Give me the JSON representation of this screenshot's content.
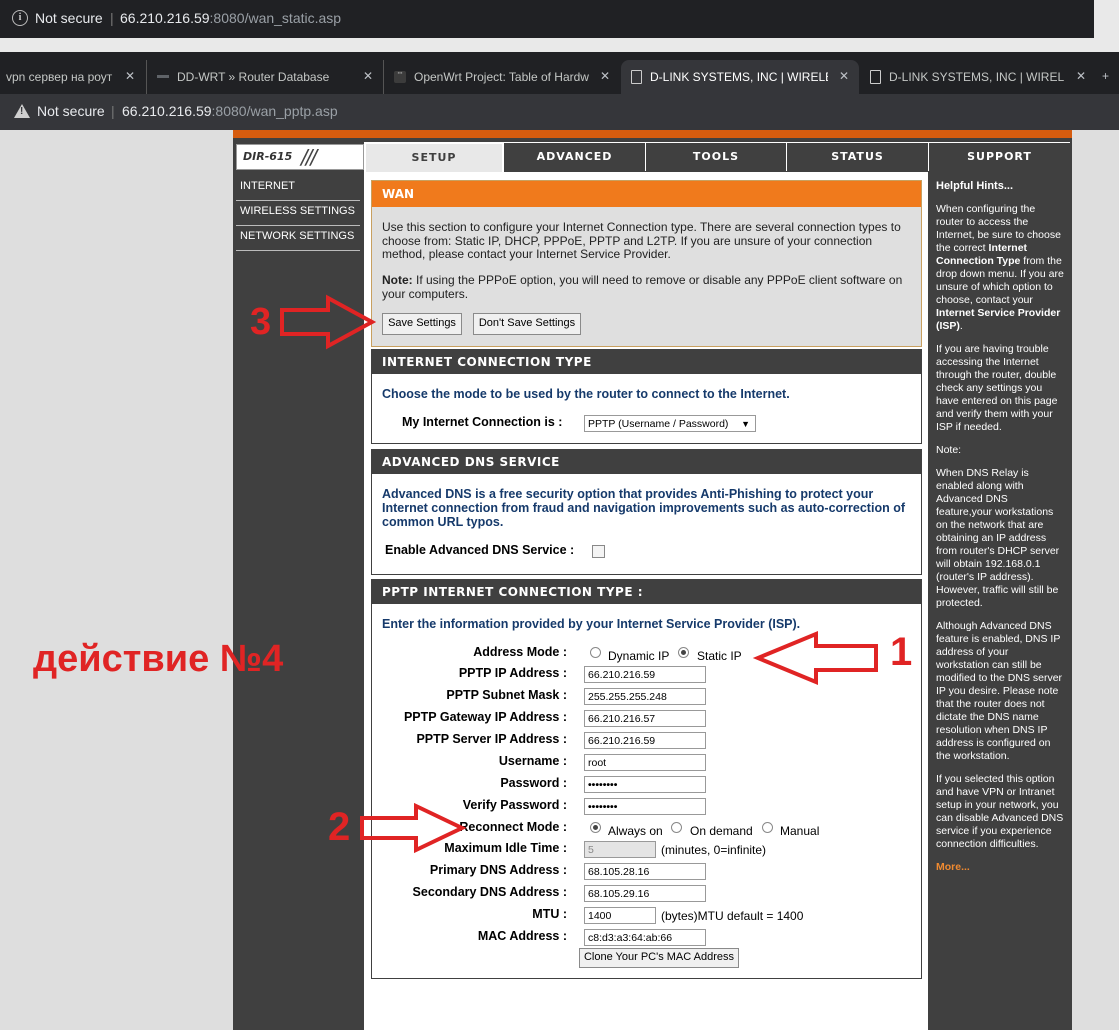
{
  "prev_window": {
    "security": "Not secure",
    "url_host": "66.210.216.59",
    "url_path": ":8080/wan_static.asp"
  },
  "tabs": [
    {
      "title": "vpn сервер на роут",
      "icon": "dash-icon"
    },
    {
      "title": "DD-WRT » Router Database",
      "icon": "dash-icon"
    },
    {
      "title": "OpenWrt Project: Table of Hardw",
      "icon": "openwrt-icon"
    },
    {
      "title": "D-LINK SYSTEMS, INC | WIRELESS",
      "icon": "document-icon",
      "active": true
    },
    {
      "title": "D-LINK SYSTEMS, INC | WIRELESS",
      "icon": "document-icon"
    }
  ],
  "address_bar": {
    "security": "Not secure",
    "url_host": "66.210.216.59",
    "url_path": ":8080/wan_pptp.asp"
  },
  "router": {
    "model": "DIR-615",
    "nav": [
      "SETUP",
      "ADVANCED",
      "TOOLS",
      "STATUS",
      "SUPPORT"
    ],
    "nav_selected": "SETUP",
    "left_menu": [
      "INTERNET",
      "WIRELESS SETTINGS",
      "NETWORK SETTINGS"
    ]
  },
  "wan": {
    "title": "WAN",
    "description": "Use this section to configure your Internet Connection type. There are several connection types to choose from: Static IP, DHCP, PPPoE, PPTP and L2TP. If you are unsure of your connection method, please contact your Internet Service Provider.",
    "note_label": "Note:",
    "note_text": " If using the PPPoE option, you will need to remove or disable any PPPoE client software on your computers.",
    "save_label": "Save Settings",
    "dont_save_label": "Don't Save Settings"
  },
  "connection_type": {
    "title": "INTERNET CONNECTION TYPE",
    "prompt": "Choose the mode to be used by the router to connect to the Internet.",
    "label": "My Internet Connection is :",
    "value": "PPTP (Username / Password)"
  },
  "dns_service": {
    "title": "ADVANCED DNS SERVICE",
    "description": "Advanced DNS is a free security option that provides Anti-Phishing to protect your Internet connection from fraud and navigation improvements such as auto-correction of common URL typos.",
    "label": "Enable Advanced DNS Service :",
    "checked": false
  },
  "pptp": {
    "title": "PPTP INTERNET CONNECTION TYPE :",
    "prompt": "Enter the information provided by your Internet Service Provider (ISP).",
    "address_mode_label": "Address Mode :",
    "address_mode_options": [
      "Dynamic IP",
      "Static IP"
    ],
    "address_mode_selected": "Static IP",
    "ip_label": "PPTP IP Address :",
    "ip": "66.210.216.59",
    "mask_label": "PPTP Subnet Mask :",
    "mask": "255.255.255.248",
    "gateway_label": "PPTP Gateway IP Address :",
    "gateway": "66.210.216.57",
    "server_label": "PPTP Server IP Address :",
    "server": "66.210.216.59",
    "username_label": "Username :",
    "username": "root",
    "password_label": "Password :",
    "password": "••••••••",
    "verify_label": "Verify Password :",
    "verify": "••••••••",
    "reconnect_label": "Reconnect Mode :",
    "reconnect_options": [
      "Always on",
      "On demand",
      "Manual"
    ],
    "reconnect_selected": "Always on",
    "idle_label": "Maximum Idle Time :",
    "idle": "5",
    "idle_hint": "(minutes, 0=infinite)",
    "dns1_label": "Primary DNS Address :",
    "dns1": "68.105.28.16",
    "dns2_label": "Secondary DNS Address :",
    "dns2": "68.105.29.16",
    "mtu_label": "MTU :",
    "mtu": "1400",
    "mtu_hint": "(bytes)MTU default = 1400",
    "mac_label": "MAC Address :",
    "mac": "c8:d3:a3:64:ab:66",
    "clone_label": "Clone Your PC's MAC Address"
  },
  "hints": {
    "title": "Helpful Hints...",
    "p1_a": "When configuring the router to access the Internet, be sure to choose the correct ",
    "p1_b": "Internet Connection Type",
    "p1_c": " from the drop down menu. If you are unsure of which option to choose, contact your ",
    "p1_d": "Internet Service Provider (ISP)",
    "p1_e": ".",
    "p2": "If you are having trouble accessing the Internet through the router, double check any settings you have entered on this page and verify them with your ISP if needed.",
    "p3": "Note:",
    "p4": "When DNS Relay is enabled along with Advanced DNS feature,your workstations on the network that are obtaining an IP address from router's DHCP server will obtain 192.168.0.1 (router's IP address). However, traffic will still be protected.",
    "p5": "Although Advanced DNS feature is enabled, DNS IP address of your workstation can still be modified to the DNS server IP you desire. Please note that the router does not dictate the DNS name resolution when DNS IP address is configured on the workstation.",
    "p6": "If you selected this option and have VPN or Intranet setup in your network, you can disable Advanced DNS service if you experience connection difficulties.",
    "more": "More..."
  },
  "annotations": {
    "step1": "1",
    "step2": "2",
    "step3": "3",
    "caption": "действие №4",
    "color": "#e02424"
  }
}
